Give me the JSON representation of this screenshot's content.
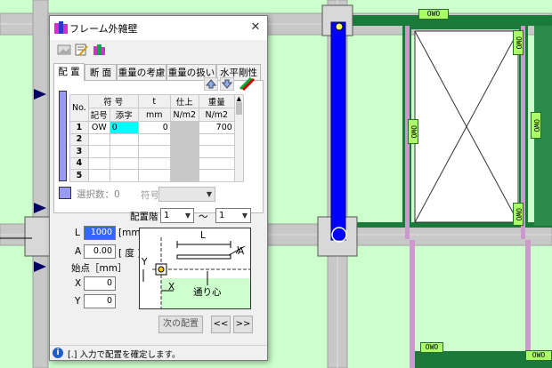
{
  "dialog": {
    "title": "フレーム外雑壁",
    "close_glyph": "✕",
    "tabs": [
      "配 置",
      "断 面",
      "重量の考慮",
      "重量の扱い",
      "水平剛性"
    ],
    "table": {
      "col_no": "No.",
      "col_fugo": "符 号",
      "col_kigo": "記号",
      "col_soeji": "添字",
      "col_t": "t",
      "col_t_unit": "mm",
      "col_shiage": "仕上",
      "col_shiage_unit": "N/m2",
      "col_juryo": "重量",
      "col_juryo_unit": "N/m2",
      "rows": [
        {
          "no": "1",
          "kigo": "OW",
          "soeji": "0",
          "t": "0",
          "shiage": "",
          "juryo": "700"
        },
        {
          "no": "2",
          "kigo": "",
          "soeji": "",
          "t": "",
          "shiage": "",
          "juryo": ""
        },
        {
          "no": "3",
          "kigo": "",
          "soeji": "",
          "t": "",
          "shiage": "",
          "juryo": ""
        },
        {
          "no": "4",
          "kigo": "",
          "soeji": "",
          "t": "",
          "shiage": "",
          "juryo": ""
        },
        {
          "no": "5",
          "kigo": "",
          "soeji": "",
          "t": "",
          "shiage": "",
          "juryo": ""
        }
      ]
    },
    "selection_label": "選択数：0",
    "fugo_label": "符号",
    "haichi_kai_label": "配置階",
    "floor_from": "1",
    "floor_to": "1",
    "tilde": "〜",
    "L_label": "L",
    "L_value": "1000",
    "L_unit": "[mm]",
    "A_label": "A",
    "A_value": "0.00",
    "A_unit": "[ 度 ]",
    "shiten_label": "始点［mm］",
    "X_label": "X",
    "X_value": "0",
    "Y_label": "Y",
    "Y_value": "0",
    "diagram": {
      "L": "L",
      "A": "A",
      "X": "X",
      "Y": "Y",
      "center": "通り心"
    },
    "next_button": "次の配置",
    "prev_nav": "<<",
    "next_nav": ">>",
    "status_text": "[.] 入力で配置を確定します。"
  },
  "canvas": {
    "owo_labels": [
      "OWO",
      "OWO",
      "OWO",
      "OWO",
      "OWO",
      "OWO",
      "OWO",
      "OWO"
    ]
  },
  "colors": {
    "background": "#ccffcc",
    "beam_gray": "#c8c8c8",
    "wall_green": "#1a7a3a",
    "selected_blue": "#0000ff",
    "owo_fill": "#aaff66"
  }
}
